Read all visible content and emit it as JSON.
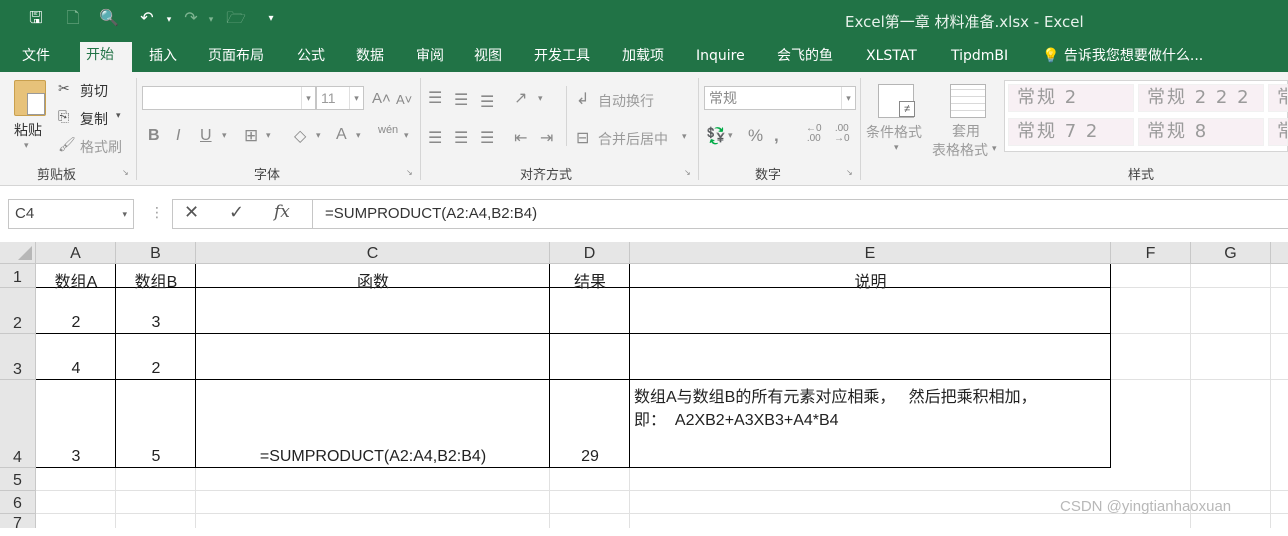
{
  "window": {
    "title": "Excel第一章 材料准备.xlsx - Excel"
  },
  "tabs": [
    "文件",
    "开始",
    "插入",
    "页面布局",
    "公式",
    "数据",
    "审阅",
    "视图",
    "开发工具",
    "加载项",
    "Inquire",
    "会飞的鱼",
    "XLSTAT",
    "TipdmBI"
  ],
  "active_tab": "开始",
  "tell_me": "告诉我您想要做什么...",
  "ribbon": {
    "clipboard": {
      "paste": "粘贴",
      "cut": "剪切",
      "copy": "复制",
      "format_painter": "格式刷",
      "label": "剪贴板"
    },
    "font": {
      "name": "",
      "size": "11",
      "label": "字体"
    },
    "alignment": {
      "wrap": "自动换行",
      "merge": "合并后居中",
      "label": "对齐方式"
    },
    "number": {
      "format": "常规",
      "label": "数字"
    },
    "styles": {
      "conditional": "条件格式",
      "table_format_1": "套用",
      "table_format_2": "表格格式",
      "label": "样式",
      "gallery": [
        "常规 2",
        "常规 2 2 2",
        "常",
        "常规 7 2",
        "常规 8",
        "常"
      ]
    }
  },
  "formula_bar": {
    "name_box": "C4",
    "formula": "=SUMPRODUCT(A2:A4,B2:B4)"
  },
  "sheet": {
    "columns": [
      "A",
      "B",
      "C",
      "D",
      "E",
      "F",
      "G"
    ],
    "rows": [
      "1",
      "2",
      "3",
      "4",
      "5",
      "6",
      "7"
    ],
    "cells": {
      "A1": "数组A",
      "B1": "数组B",
      "C1": "函数",
      "D1": "结果",
      "E1": "说明",
      "A2": "2",
      "B2": "3",
      "A3": "4",
      "B3": "2",
      "A4": "3",
      "B4": "5",
      "C4": "=SUMPRODUCT(A2:A4,B2:B4)",
      "D4": "29",
      "E4_line1": "数组A与数组B的所有元素对应相乘，   然后把乘积相加，",
      "E4_line2": "即：  A2XB2+A3XB3+A4*B4"
    }
  },
  "watermark": "CSDN @yingtianhaoxuan"
}
